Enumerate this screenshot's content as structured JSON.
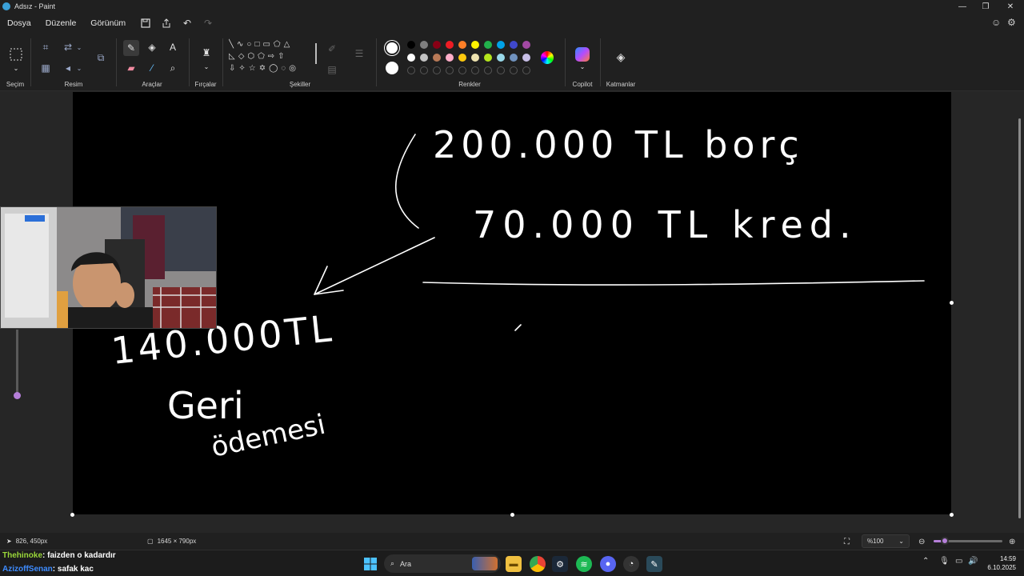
{
  "window": {
    "title": "Adsız - Paint"
  },
  "menu": {
    "file": "Dosya",
    "edit": "Düzenle",
    "view": "Görünüm"
  },
  "ribbon": {
    "groups": {
      "selection": "Seçim",
      "image": "Resim",
      "tools": "Araçlar",
      "brushes": "Fırçalar",
      "shapes": "Şekiller",
      "colors": "Renkler",
      "copilot": "Copilot",
      "layers": "Katmanlar"
    },
    "palette_row1": [
      "#000000",
      "#7f7f7f",
      "#880015",
      "#ed1c24",
      "#ff7f27",
      "#fff200",
      "#22b14c",
      "#00a2e8",
      "#3f48cc",
      "#a349a4"
    ],
    "palette_row2": [
      "#ffffff",
      "#c3c3c3",
      "#b97a57",
      "#ffaec9",
      "#ffc90e",
      "#efe4b0",
      "#b5e61d",
      "#99d9ea",
      "#7092be",
      "#c8bfe7"
    ],
    "primary_color": "#ffffff",
    "secondary_color": "#ffffff"
  },
  "canvas": {
    "background": "#000000",
    "handwriting": {
      "line1": "200.000 TL borç",
      "line2": "70.000 TL kred.",
      "total": "140.000TL",
      "note1": "Geri",
      "note2": "ödemesi"
    }
  },
  "status": {
    "cursor_pos": "826, 450px",
    "canvas_size": "1645 × 790px",
    "zoom": "%100",
    "zoom_fraction": 0.16
  },
  "stream_chat": [
    {
      "user": "Thehinoke",
      "message": ": faizden o kadardır"
    },
    {
      "user": "AzizoffSenan",
      "message": ": safak kac"
    }
  ],
  "taskbar": {
    "search_placeholder": "Ara",
    "time": "14:59",
    "date": "6.10.2025"
  }
}
